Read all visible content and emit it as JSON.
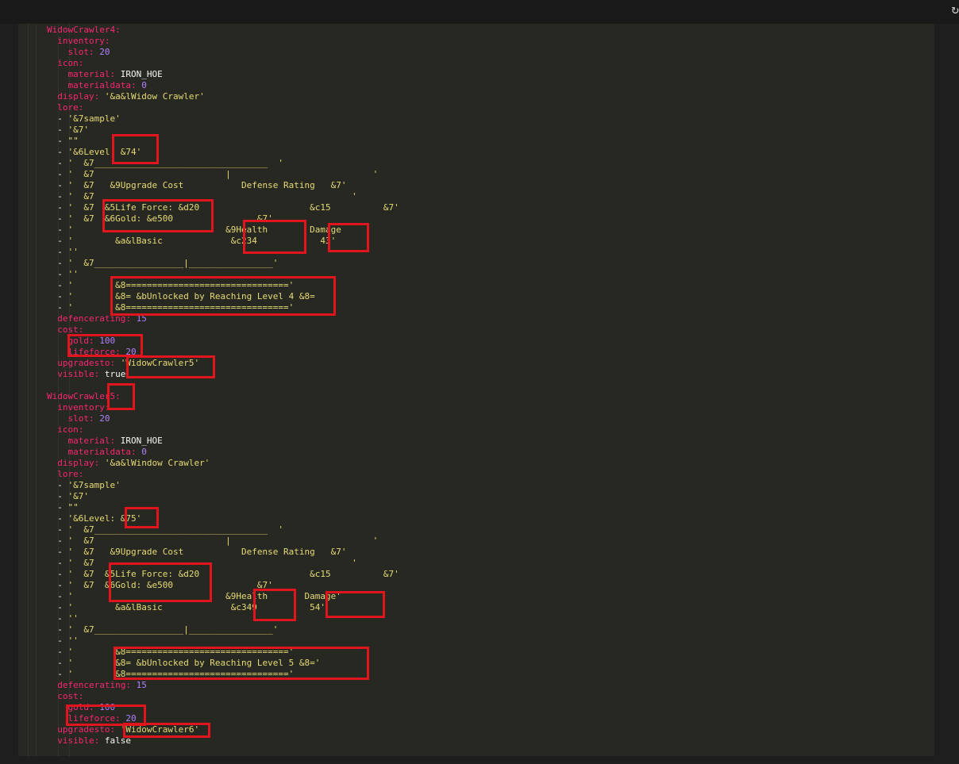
{
  "editor": {
    "lines": [
      [
        {
          "t": "WidowCrawler4:",
          "c": "k"
        }
      ],
      [
        {
          "t": "  "
        },
        {
          "t": "inventory:",
          "c": "k"
        }
      ],
      [
        {
          "t": "    "
        },
        {
          "t": "slot:",
          "c": "k"
        },
        {
          "t": " "
        },
        {
          "t": "20",
          "c": "n"
        }
      ],
      [
        {
          "t": "  "
        },
        {
          "t": "icon:",
          "c": "k"
        }
      ],
      [
        {
          "t": "    "
        },
        {
          "t": "material:",
          "c": "k"
        },
        {
          "t": " IRON_HOE",
          "c": "p"
        }
      ],
      [
        {
          "t": "    "
        },
        {
          "t": "materialdata:",
          "c": "k"
        },
        {
          "t": " "
        },
        {
          "t": "0",
          "c": "n"
        }
      ],
      [
        {
          "t": "  "
        },
        {
          "t": "display:",
          "c": "k"
        },
        {
          "t": " '&a&lWidow Crawler'",
          "c": "s"
        }
      ],
      [
        {
          "t": "  "
        },
        {
          "t": "lore:",
          "c": "k"
        }
      ],
      [
        {
          "t": "  - ",
          "c": "p"
        },
        {
          "t": "'&7sample'",
          "c": "s"
        }
      ],
      [
        {
          "t": "  - ",
          "c": "p"
        },
        {
          "t": "'&7'",
          "c": "s"
        }
      ],
      [
        {
          "t": "  - ",
          "c": "p"
        },
        {
          "t": "\"\"",
          "c": "s"
        }
      ],
      [
        {
          "t": "  - ",
          "c": "p"
        },
        {
          "t": "'&6Level: &74'",
          "c": "s"
        }
      ],
      [
        {
          "t": "  - ",
          "c": "p"
        },
        {
          "t": "'  &7_________________________________  '",
          "c": "s"
        }
      ],
      [
        {
          "t": "  - ",
          "c": "p"
        },
        {
          "t": "'  &7                         |                           '",
          "c": "s"
        }
      ],
      [
        {
          "t": "  - ",
          "c": "p"
        },
        {
          "t": "'  &7   &9Upgrade Cost           Defense Rating   &7'",
          "c": "s"
        }
      ],
      [
        {
          "t": "  - ",
          "c": "p"
        },
        {
          "t": "'  &7                                                 '",
          "c": "s"
        }
      ],
      [
        {
          "t": "  - ",
          "c": "p"
        },
        {
          "t": "'  &7  &5Life Force: &d20                     &c15          &7'",
          "c": "s"
        }
      ],
      [
        {
          "t": "  - ",
          "c": "p"
        },
        {
          "t": "'  &7  &6Gold: &e500                &7'",
          "c": "s"
        }
      ],
      [
        {
          "t": "  - ",
          "c": "p"
        },
        {
          "t": "'                             &9Health        Damage",
          "c": "s"
        }
      ],
      [
        {
          "t": "  - ",
          "c": "p"
        },
        {
          "t": "'        &a&lBasic             &c234            43'",
          "c": "s"
        }
      ],
      [
        {
          "t": "  - ",
          "c": "p"
        },
        {
          "t": "''",
          "c": "s"
        }
      ],
      [
        {
          "t": "  - ",
          "c": "p"
        },
        {
          "t": "'  &7_________________|________________'",
          "c": "s"
        }
      ],
      [
        {
          "t": "  - ",
          "c": "p"
        },
        {
          "t": "''",
          "c": "s"
        }
      ],
      [
        {
          "t": "  - ",
          "c": "p"
        },
        {
          "t": "'        &8==============================='",
          "c": "s"
        }
      ],
      [
        {
          "t": "  - ",
          "c": "p"
        },
        {
          "t": "'        &8= &bUnlocked by Reaching Level 4 &8=",
          "c": "s"
        }
      ],
      [
        {
          "t": "  - ",
          "c": "p"
        },
        {
          "t": "'        &8==============================='",
          "c": "s"
        }
      ],
      [
        {
          "t": "  "
        },
        {
          "t": "defencerating:",
          "c": "k"
        },
        {
          "t": " "
        },
        {
          "t": "15",
          "c": "n"
        }
      ],
      [
        {
          "t": "  "
        },
        {
          "t": "cost:",
          "c": "k"
        }
      ],
      [
        {
          "t": "    "
        },
        {
          "t": "gold:",
          "c": "k"
        },
        {
          "t": " "
        },
        {
          "t": "100",
          "c": "n"
        }
      ],
      [
        {
          "t": "    "
        },
        {
          "t": "lifeforce:",
          "c": "k"
        },
        {
          "t": " "
        },
        {
          "t": "20",
          "c": "n"
        }
      ],
      [
        {
          "t": "  "
        },
        {
          "t": "upgradesto:",
          "c": "k"
        },
        {
          "t": " 'WidowCrawler5'",
          "c": "s"
        }
      ],
      [
        {
          "t": "  "
        },
        {
          "t": "visible:",
          "c": "k"
        },
        {
          "t": " true",
          "c": "p"
        }
      ],
      [
        {
          "t": ""
        }
      ],
      [
        {
          "t": "WidowCrawler5:",
          "c": "k"
        }
      ],
      [
        {
          "t": "  "
        },
        {
          "t": "inventory:",
          "c": "k"
        }
      ],
      [
        {
          "t": "    "
        },
        {
          "t": "slot:",
          "c": "k"
        },
        {
          "t": " "
        },
        {
          "t": "20",
          "c": "n"
        }
      ],
      [
        {
          "t": "  "
        },
        {
          "t": "icon:",
          "c": "k"
        }
      ],
      [
        {
          "t": "    "
        },
        {
          "t": "material:",
          "c": "k"
        },
        {
          "t": " IRON_HOE",
          "c": "p"
        }
      ],
      [
        {
          "t": "    "
        },
        {
          "t": "materialdata:",
          "c": "k"
        },
        {
          "t": " "
        },
        {
          "t": "0",
          "c": "n"
        }
      ],
      [
        {
          "t": "  "
        },
        {
          "t": "display:",
          "c": "k"
        },
        {
          "t": " '&a&lWindow Crawler'",
          "c": "s"
        }
      ],
      [
        {
          "t": "  "
        },
        {
          "t": "lore:",
          "c": "k"
        }
      ],
      [
        {
          "t": "  - ",
          "c": "p"
        },
        {
          "t": "'&7sample'",
          "c": "s"
        }
      ],
      [
        {
          "t": "  - ",
          "c": "p"
        },
        {
          "t": "'&7'",
          "c": "s"
        }
      ],
      [
        {
          "t": "  - ",
          "c": "p"
        },
        {
          "t": "\"\"",
          "c": "s"
        }
      ],
      [
        {
          "t": "  - ",
          "c": "p"
        },
        {
          "t": "'&6Level: &75'",
          "c": "s"
        }
      ],
      [
        {
          "t": "  - ",
          "c": "p"
        },
        {
          "t": "'  &7_________________________________  '",
          "c": "s"
        }
      ],
      [
        {
          "t": "  - ",
          "c": "p"
        },
        {
          "t": "'  &7                         |                           '",
          "c": "s"
        }
      ],
      [
        {
          "t": "  - ",
          "c": "p"
        },
        {
          "t": "'  &7   &9Upgrade Cost           Defense Rating   &7'",
          "c": "s"
        }
      ],
      [
        {
          "t": "  - ",
          "c": "p"
        },
        {
          "t": "'  &7                                                 '",
          "c": "s"
        }
      ],
      [
        {
          "t": "  - ",
          "c": "p"
        },
        {
          "t": "'  &7  &5Life Force: &d20                     &c15          &7'",
          "c": "s"
        }
      ],
      [
        {
          "t": "  - ",
          "c": "p"
        },
        {
          "t": "'  &7  &6Gold: &e500                &7'",
          "c": "s"
        }
      ],
      [
        {
          "t": "  - ",
          "c": "p"
        },
        {
          "t": "'                             &9Health       Damage'",
          "c": "s"
        }
      ],
      [
        {
          "t": "  - ",
          "c": "p"
        },
        {
          "t": "'        &a&lBasic             &c349          54'",
          "c": "s"
        }
      ],
      [
        {
          "t": "  - ",
          "c": "p"
        },
        {
          "t": "''",
          "c": "s"
        }
      ],
      [
        {
          "t": "  - ",
          "c": "p"
        },
        {
          "t": "'  &7_________________|________________'",
          "c": "s"
        }
      ],
      [
        {
          "t": "  - ",
          "c": "p"
        },
        {
          "t": "''",
          "c": "s"
        }
      ],
      [
        {
          "t": "  - ",
          "c": "p"
        },
        {
          "t": "'        &8==============================='",
          "c": "s"
        }
      ],
      [
        {
          "t": "  - ",
          "c": "p"
        },
        {
          "t": "'        &8= &bUnlocked by Reaching Level 5 &8='",
          "c": "s"
        }
      ],
      [
        {
          "t": "  - ",
          "c": "p"
        },
        {
          "t": "'        &8==============================='",
          "c": "s"
        }
      ],
      [
        {
          "t": "  "
        },
        {
          "t": "defencerating:",
          "c": "k"
        },
        {
          "t": " "
        },
        {
          "t": "15",
          "c": "n"
        }
      ],
      [
        {
          "t": "  "
        },
        {
          "t": "cost:",
          "c": "k"
        }
      ],
      [
        {
          "t": "    "
        },
        {
          "t": "gold:",
          "c": "k"
        },
        {
          "t": " "
        },
        {
          "t": "100",
          "c": "n"
        }
      ],
      [
        {
          "t": "    "
        },
        {
          "t": "lifeforce:",
          "c": "k"
        },
        {
          "t": " "
        },
        {
          "t": "20",
          "c": "n"
        }
      ],
      [
        {
          "t": "  "
        },
        {
          "t": "upgradesto:",
          "c": "k"
        },
        {
          "t": " 'WidowCrawler6'",
          "c": "s"
        }
      ],
      [
        {
          "t": "  "
        },
        {
          "t": "visible:",
          "c": "k"
        },
        {
          "t": " false",
          "c": "p"
        }
      ]
    ]
  },
  "colors": {
    "key": "#f92672",
    "string": "#e6db74",
    "number": "#ae81ff",
    "plain": "#f8f8f2",
    "background": "#272822",
    "annotation": "#e0151d"
  },
  "icons": {
    "corner": "refresh-icon"
  }
}
